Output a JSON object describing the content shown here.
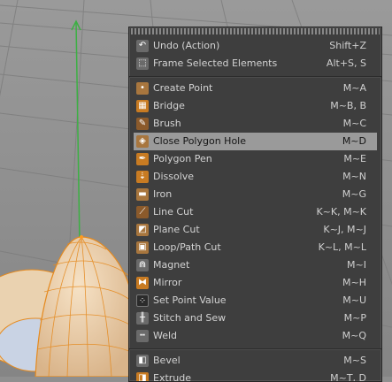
{
  "menu": {
    "sections": [
      [
        {
          "label": "Undo (Action)",
          "shortcut": "Shift+Z",
          "icon": "undo-icon",
          "glyph": "↶",
          "tone": "gray"
        },
        {
          "label": "Frame Selected Elements",
          "shortcut": "Alt+S, S",
          "icon": "frame-selected-icon",
          "glyph": "⬚",
          "tone": "gray"
        }
      ],
      [
        {
          "label": "Create Point",
          "shortcut": "M~A",
          "icon": "create-point-icon",
          "glyph": "•",
          "tone": "tan"
        },
        {
          "label": "Bridge",
          "shortcut": "M~B, B",
          "icon": "bridge-icon",
          "glyph": "▦",
          "tone": "orange"
        },
        {
          "label": "Brush",
          "shortcut": "M~C",
          "icon": "brush-icon",
          "glyph": "✎",
          "tone": "brown"
        },
        {
          "label": "Close Polygon Hole",
          "shortcut": "M~D",
          "icon": "close-polygon-hole-icon",
          "glyph": "◈",
          "tone": "tan",
          "highlighted": true
        },
        {
          "label": "Polygon Pen",
          "shortcut": "M~E",
          "icon": "polygon-pen-icon",
          "glyph": "✒",
          "tone": "orange"
        },
        {
          "label": "Dissolve",
          "shortcut": "M~N",
          "icon": "dissolve-icon",
          "glyph": "⇣",
          "tone": "orange"
        },
        {
          "label": "Iron",
          "shortcut": "M~G",
          "icon": "iron-icon",
          "glyph": "▬",
          "tone": "tan"
        },
        {
          "label": "Line Cut",
          "shortcut": "K~K, M~K",
          "icon": "line-cut-icon",
          "glyph": "⟋",
          "tone": "brown"
        },
        {
          "label": "Plane Cut",
          "shortcut": "K~J, M~J",
          "icon": "plane-cut-icon",
          "glyph": "◩",
          "tone": "tan"
        },
        {
          "label": "Loop/Path Cut",
          "shortcut": "K~L, M~L",
          "icon": "loop-path-cut-icon",
          "glyph": "▣",
          "tone": "tan"
        },
        {
          "label": "Magnet",
          "shortcut": "M~I",
          "icon": "magnet-icon",
          "glyph": "⋒",
          "tone": "gray"
        },
        {
          "label": "Mirror",
          "shortcut": "M~H",
          "icon": "mirror-icon",
          "glyph": "⧓",
          "tone": "orange"
        },
        {
          "label": "Set Point Value",
          "shortcut": "M~U",
          "icon": "set-point-value-icon",
          "glyph": "⁘",
          "tone": "dark"
        },
        {
          "label": "Stitch and Sew",
          "shortcut": "M~P",
          "icon": "stitch-and-sew-icon",
          "glyph": "╫",
          "tone": "gray"
        },
        {
          "label": "Weld",
          "shortcut": "M~Q",
          "icon": "weld-icon",
          "glyph": "┅",
          "tone": "gray"
        }
      ],
      [
        {
          "label": "Bevel",
          "shortcut": "M~S",
          "icon": "bevel-icon",
          "glyph": "◧",
          "tone": "gray"
        },
        {
          "label": "Extrude",
          "shortcut": "M~T, D",
          "icon": "extrude-icon",
          "glyph": "◨",
          "tone": "orange"
        }
      ]
    ]
  },
  "colors": {
    "menu_bg": "#3e3e3e",
    "highlight": "#9a9a9a",
    "mesh_fill": "#e9cba5",
    "mesh_wire": "#e58a1f",
    "y_axis": "#3cb043"
  }
}
